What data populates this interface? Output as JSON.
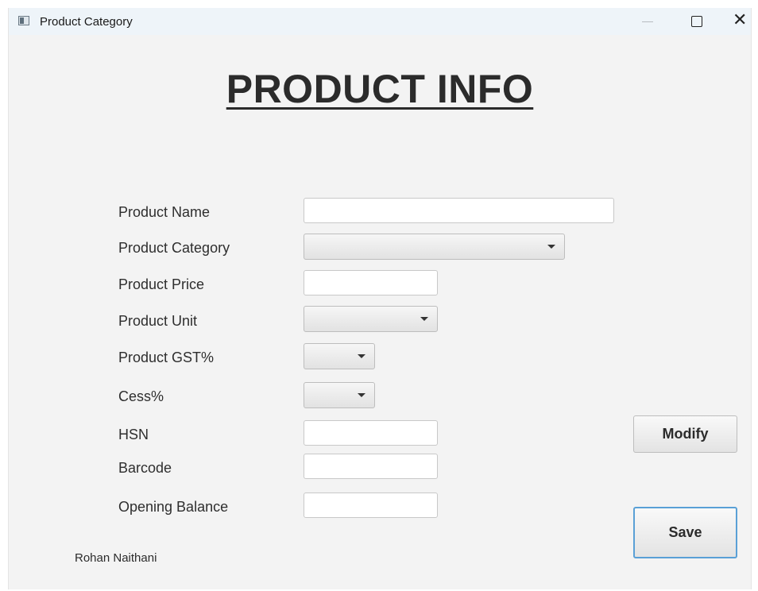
{
  "window": {
    "title": "Product Category"
  },
  "heading": "PRODUCT INFO",
  "form": {
    "product_name_label": "Product Name",
    "product_name_value": "",
    "product_category_label": "Product Category",
    "product_category_value": "",
    "product_price_label": "Product Price",
    "product_price_value": "",
    "product_unit_label": "Product Unit",
    "product_unit_value": "",
    "product_gst_label": "Product GST%",
    "product_gst_value": "",
    "cess_label": "Cess%",
    "cess_value": "",
    "hsn_label": "HSN",
    "hsn_value": "",
    "barcode_label": "Barcode",
    "barcode_value": "",
    "opening_balance_label": "Opening Balance",
    "opening_balance_value": ""
  },
  "buttons": {
    "modify": "Modify",
    "save": "Save"
  },
  "footer": {
    "author": "Rohan Naithani"
  },
  "icons": {
    "app": "app-window-icon",
    "minimize": "minimize-icon",
    "maximize": "maximize-icon",
    "close": "close-icon",
    "dropdown": "chevron-down-icon"
  },
  "colors": {
    "titlebar": "#eef4f9",
    "background": "#f3f3f3",
    "focus_border": "#5aa0d6"
  }
}
